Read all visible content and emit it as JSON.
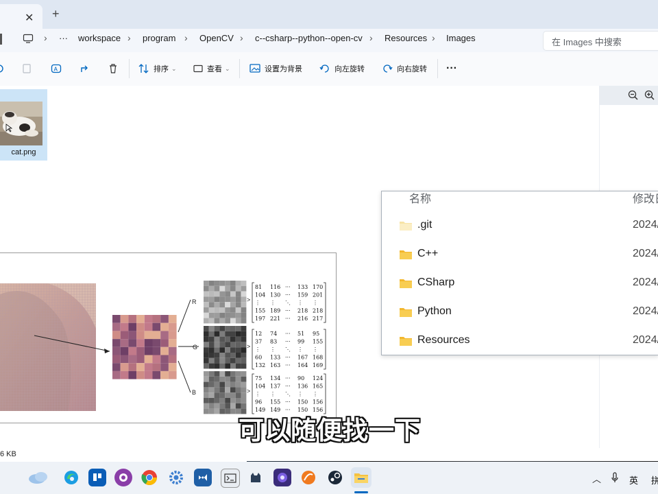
{
  "tabbar": {
    "close_glyph": "✕",
    "new_tab_glyph": "+"
  },
  "address": {
    "more": "···",
    "crumbs": [
      "workspace",
      "program",
      "OpenCV",
      "c--csharp--python--open-cv",
      "Resources",
      "Images"
    ],
    "search_placeholder": "在 Images 中搜索"
  },
  "commands": {
    "sort": "排序",
    "view": "查看",
    "set_background": "设置为背景",
    "rotate_left": "向左旋转",
    "rotate_right": "向右旋转",
    "more": "···"
  },
  "files": [
    {
      "name": "cat.png",
      "icon": "image-thumbnail",
      "selected": true
    }
  ],
  "popup": {
    "col_name": "名称",
    "col_modified": "修改日",
    "rows": [
      {
        "name": ".git",
        "date": "2024/",
        "icon": "folder-icon-pale"
      },
      {
        "name": "C++",
        "date": "2024/",
        "icon": "folder-icon"
      },
      {
        "name": "CSharp",
        "date": "2024/",
        "icon": "folder-icon"
      },
      {
        "name": "Python",
        "date": "2024/",
        "icon": "folder-icon"
      },
      {
        "name": "Resources",
        "date": "2024/",
        "icon": "folder-icon"
      }
    ]
  },
  "figure": {
    "labels": {
      "r": "R",
      "g": "G",
      "b": "B"
    },
    "matrices": {
      "r": [
        [
          "81",
          "116",
          "···",
          "133",
          "170"
        ],
        [
          "104",
          "130",
          "···",
          "159",
          "201"
        ],
        [
          "⋮",
          "⋮",
          "⋱",
          "⋮",
          "⋮"
        ],
        [
          "155",
          "189",
          "···",
          "218",
          "218"
        ],
        [
          "197",
          "221",
          "···",
          "216",
          "217"
        ]
      ],
      "g": [
        [
          "12",
          "74",
          "···",
          "51",
          "95"
        ],
        [
          "37",
          "83",
          "···",
          "99",
          "155"
        ],
        [
          "⋮",
          "⋮",
          "⋱",
          "⋮",
          "⋮"
        ],
        [
          "60",
          "133",
          "···",
          "167",
          "168"
        ],
        [
          "132",
          "163",
          "···",
          "164",
          "169"
        ]
      ],
      "b": [
        [
          "75",
          "134",
          "···",
          "90",
          "124"
        ],
        [
          "104",
          "137",
          "···",
          "136",
          "165"
        ],
        [
          "⋮",
          "⋮",
          "⋱",
          "⋮",
          "⋮"
        ],
        [
          "96",
          "155",
          "···",
          "150",
          "156"
        ],
        [
          "149",
          "149",
          "···",
          "150",
          "156"
        ]
      ]
    }
  },
  "status": {
    "size_text": "6 KB"
  },
  "subtitle": "可以随便找一下",
  "tray": {
    "lang": "英",
    "ime": "拼"
  },
  "colors": {
    "accent": "#0067c0",
    "selected_tile": "#cce4f7",
    "folder": "#f5c242"
  }
}
